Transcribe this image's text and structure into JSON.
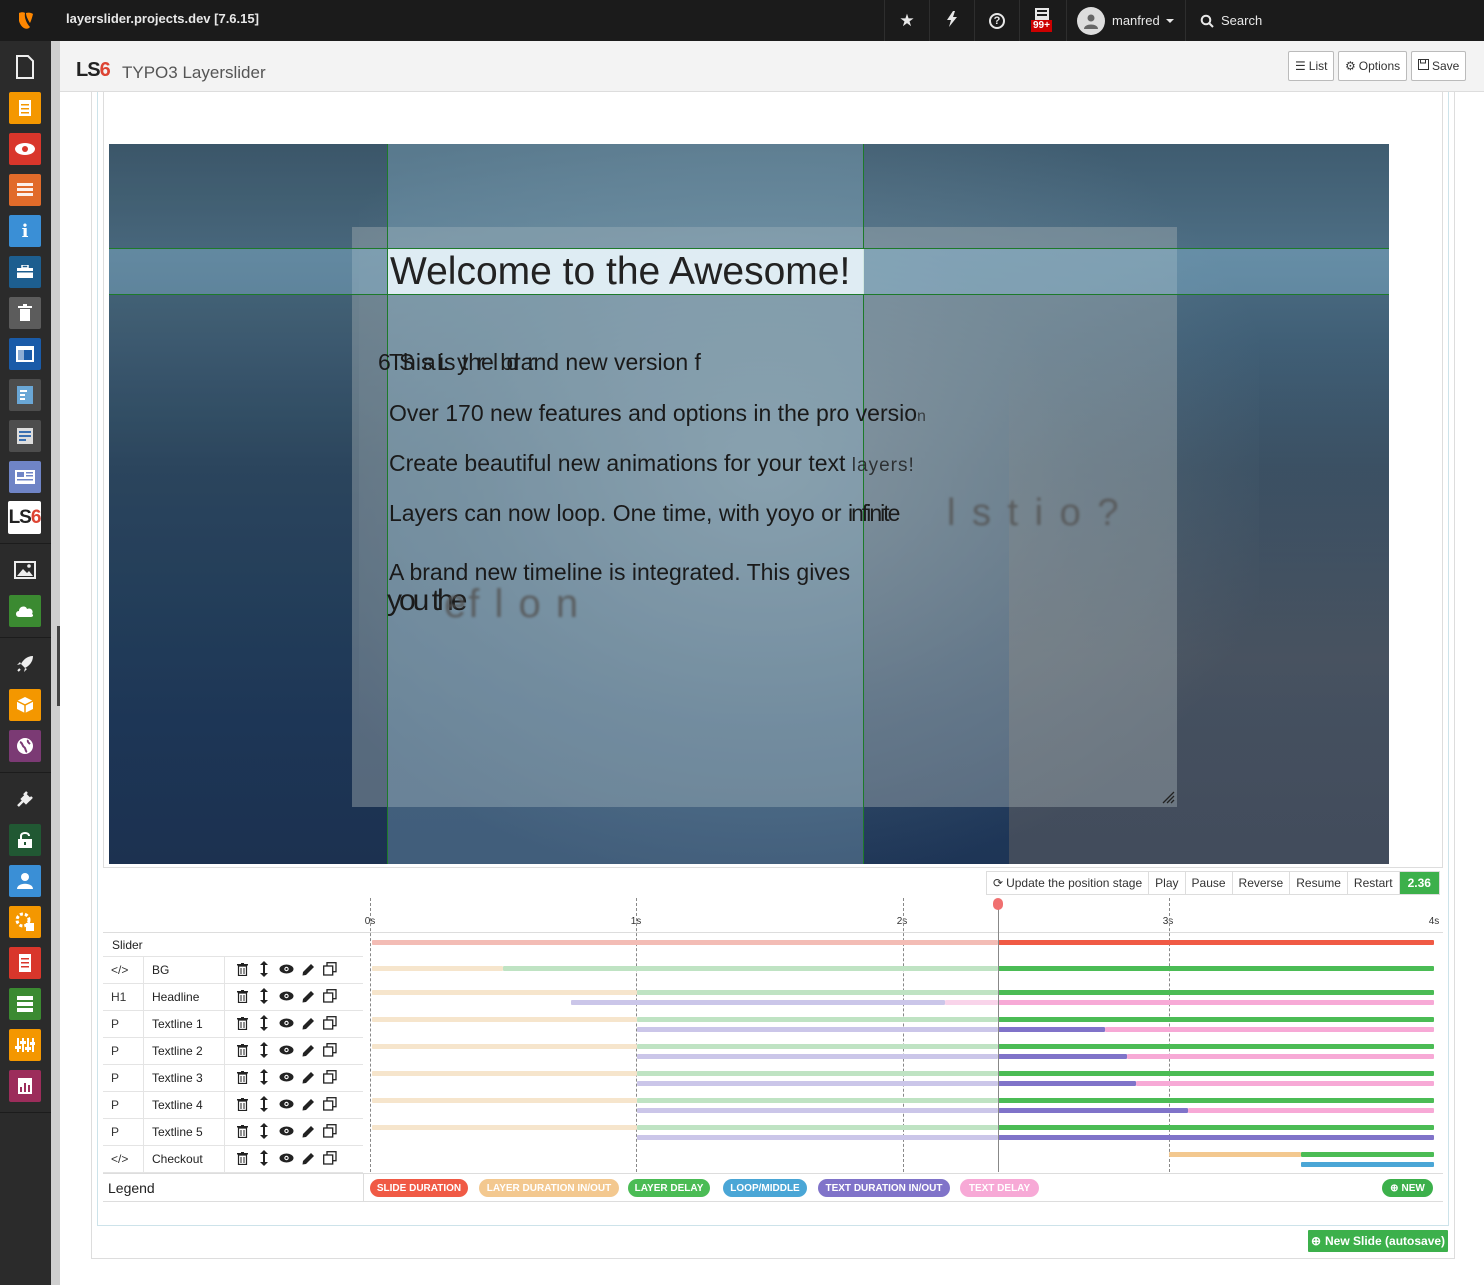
{
  "topbar": {
    "site_title": "layerslider.projects.dev [7.6.15]",
    "notification_badge": "99+",
    "username": "manfred",
    "search_label": "Search"
  },
  "docheader": {
    "module_logo": "LS6",
    "module_title": "TYPO3 Layerslider",
    "list_label": "List",
    "options_label": "Options",
    "save_label": "Save"
  },
  "sidebar_icons": [
    "page-icon",
    "file-list-icon",
    "view-icon",
    "list-icon",
    "info-icon",
    "briefcase-icon",
    "trash-icon",
    "layout-icon",
    "filelist-icon",
    "form-icon",
    "news-icon",
    "layerslider-icon",
    "image-icon",
    "cloud-icon",
    "rocket-icon",
    "extension-icon",
    "globe-icon",
    "plug-icon",
    "lock-icon",
    "user-icon",
    "scheduler-icon",
    "report-icon",
    "db-icon",
    "config-icon",
    "stats-icon"
  ],
  "stage": {
    "headline": "Welcome to the Awesome!",
    "line1": "This is the brand new version f",
    "line1_ghost": "6 S aL   y     r           l              d                        r",
    "line2": "Over 170 new features and options in the pro versio",
    "line2_tail": "n",
    "line3": "Create beautiful new animations for your text ",
    "line3_tail": "layers!",
    "line4": "Layers can now loop. One time, with yoyo or ",
    "line4_tail": "infinite",
    "line4_ghost": "l s t i o ?",
    "line5": "A brand new timeline is integrated. This gives",
    "line5b": "you the",
    "line5b_ghost": "ef l o n"
  },
  "controls": {
    "update_label": "Update the position stage",
    "play": "Play",
    "pause": "Pause",
    "reverse": "Reverse",
    "resume": "Resume",
    "restart": "Restart",
    "time": "2.36"
  },
  "timeline": {
    "ruler": [
      "0s",
      "1s",
      "2s",
      "3s",
      "4s"
    ],
    "slider_label": "Slider",
    "rows": [
      {
        "tag": "</>",
        "name": "BG"
      },
      {
        "tag": "H1",
        "name": "Headline"
      },
      {
        "tag": "P",
        "name": "Textline 1"
      },
      {
        "tag": "P",
        "name": "Textline 2"
      },
      {
        "tag": "P",
        "name": "Textline 3"
      },
      {
        "tag": "P",
        "name": "Textline 4"
      },
      {
        "tag": "P",
        "name": "Textline 5"
      },
      {
        "tag": "</>",
        "name": "Checkout"
      }
    ]
  },
  "legend": {
    "title": "Legend",
    "items": [
      {
        "label": "Slide duration",
        "color": "#f05a45"
      },
      {
        "label": "Layer duration in/out",
        "color": "#f3c88f"
      },
      {
        "label": "Layer delay",
        "color": "#4bbc55"
      },
      {
        "label": "Loop/Middle",
        "color": "#4aa6d6"
      },
      {
        "label": "Text duration in/out",
        "color": "#8073c9"
      },
      {
        "label": "Text delay",
        "color": "#f7a9d6"
      }
    ],
    "new_label": "NEW"
  },
  "new_slide_label": "New Slide (autosave)"
}
